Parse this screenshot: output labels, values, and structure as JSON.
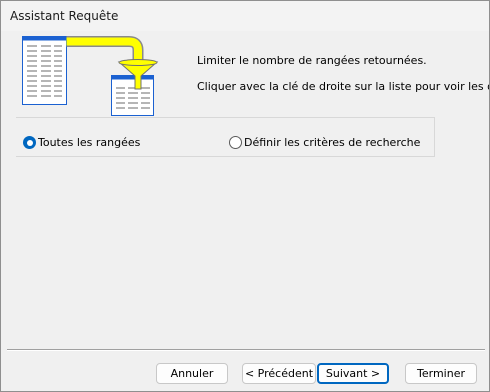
{
  "window": {
    "title": "Assistant Requête"
  },
  "illustration": {
    "icon": "filter-table-icon",
    "arrow_color": "#ffff00",
    "funnel_color": "#ffff00",
    "table_header_color": "#1b61d1"
  },
  "info": {
    "line1": "Limiter le nombre de rangées retournées.",
    "line2": "Cliquer avec la clé de droite sur la liste pour voir les options d"
  },
  "options": {
    "all_rows": {
      "label": "Toutes les rangées",
      "checked": true
    },
    "criteria": {
      "label": "Définir les critères de recherche",
      "checked": false
    }
  },
  "buttons": {
    "cancel": "Annuler",
    "previous": "< Précédent",
    "next": "Suivant >",
    "finish": "Terminer"
  },
  "colors": {
    "accent": "#0067c0",
    "window_bg": "#f0f0f0"
  }
}
